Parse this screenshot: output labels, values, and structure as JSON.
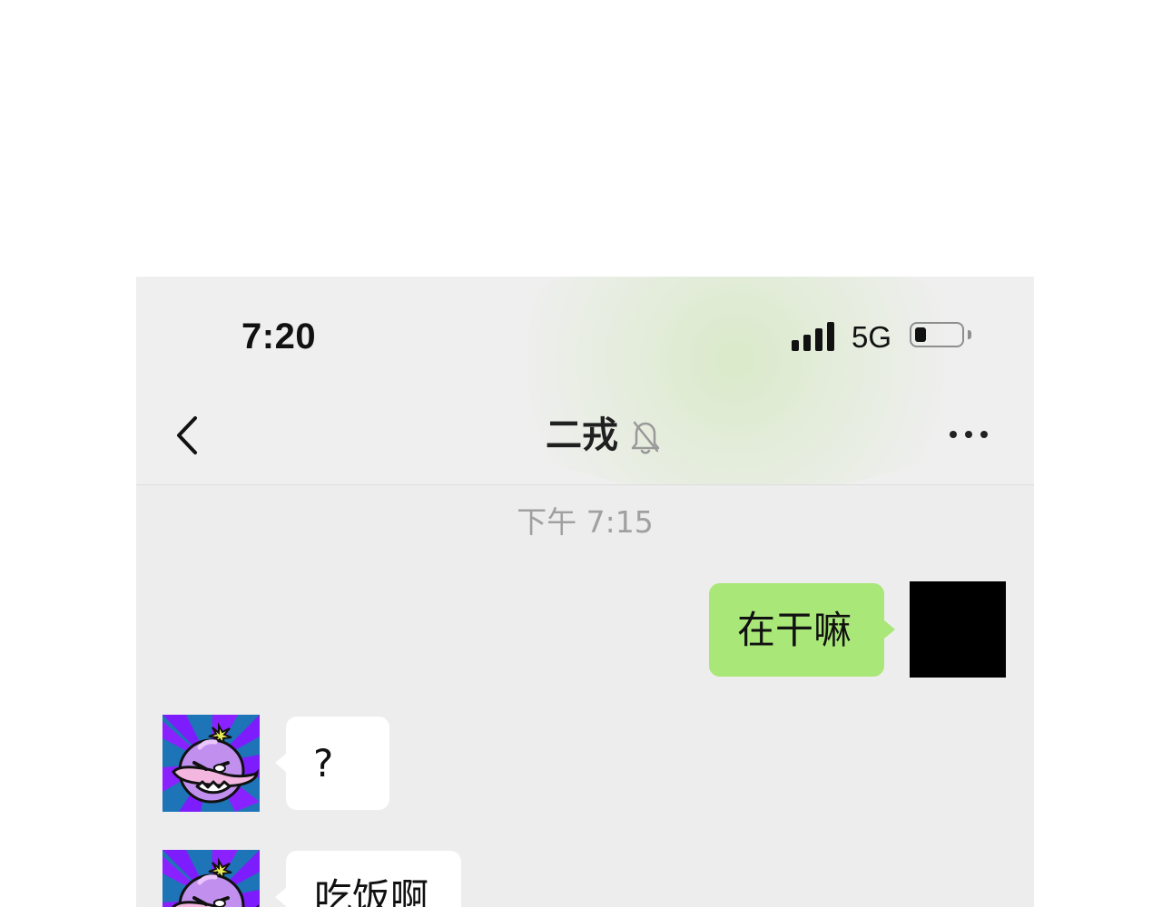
{
  "status_bar": {
    "time": "7:20",
    "network": "5G",
    "signal_icon": "cellular-signal-icon",
    "battery_icon": "battery-low-icon"
  },
  "header": {
    "title": "二戎",
    "back_icon": "chevron-left-icon",
    "mute_icon": "bell-slash-icon",
    "more_icon": "more-horizontal-icon"
  },
  "chat": {
    "timestamp": "下午 7:15",
    "messages": [
      {
        "sender": "me",
        "text": "在干嘛"
      },
      {
        "sender": "other",
        "text": "?"
      },
      {
        "sender": "other",
        "text": "吃饭啊"
      }
    ]
  },
  "colors": {
    "outgoing_bubble": "#a9e778",
    "incoming_bubble": "#ffffff",
    "chat_background": "#ededed",
    "timestamp_text": "#a0a0a0"
  }
}
